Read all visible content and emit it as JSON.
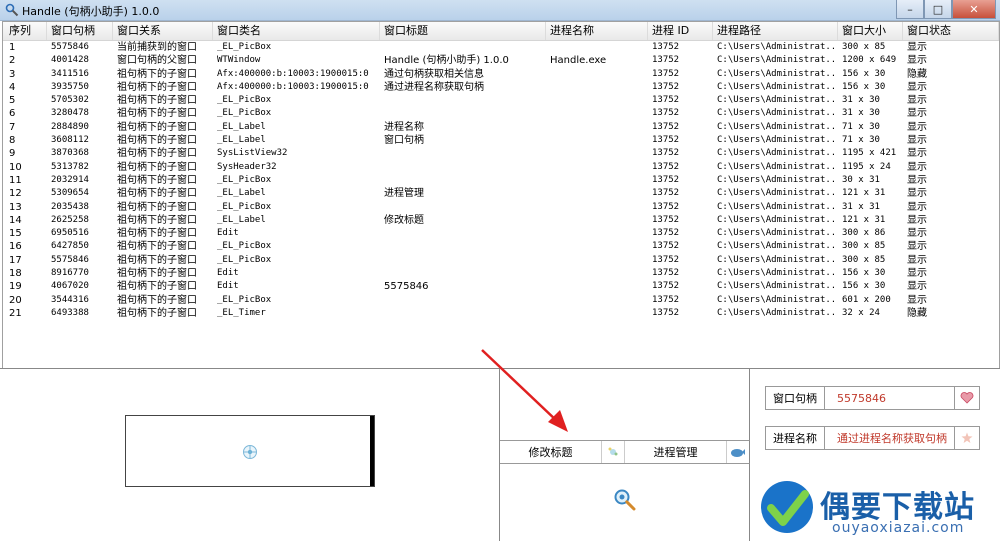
{
  "window": {
    "title": "Handle (句柄小助手) 1.0.0",
    "min": "–",
    "max": "□",
    "close": "✕"
  },
  "table": {
    "columns": [
      "序列",
      "窗口句柄",
      "窗口关系",
      "窗口类名",
      "窗口标题",
      "进程名称",
      "进程 ID",
      "进程路径",
      "窗口大小",
      "窗口状态"
    ],
    "rows": [
      [
        "1",
        "5575846",
        "当前捕获到的窗口",
        "_EL_PicBox",
        "",
        "",
        "13752",
        "C:\\Users\\Administrat...",
        "300 x 85",
        "显示"
      ],
      [
        "2",
        "4001428",
        "窗口句柄的父窗口",
        "WTWindow",
        "Handle (句柄小助手) 1.0.0",
        "Handle.exe",
        "13752",
        "C:\\Users\\Administrat...",
        "1200 x 649",
        "显示"
      ],
      [
        "3",
        "3411516",
        "祖句柄下的子窗口",
        "Afx:400000:b:10003:1900015:0",
        "通过句柄获取相关信息",
        "",
        "13752",
        "C:\\Users\\Administrat...",
        "156 x 30",
        "隐藏"
      ],
      [
        "4",
        "3935750",
        "祖句柄下的子窗口",
        "Afx:400000:b:10003:1900015:0",
        "通过进程名称获取句柄",
        "",
        "13752",
        "C:\\Users\\Administrat...",
        "156 x 30",
        "显示"
      ],
      [
        "5",
        "5705302",
        "祖句柄下的子窗口",
        "_EL_PicBox",
        "",
        "",
        "13752",
        "C:\\Users\\Administrat...",
        "31 x 30",
        "显示"
      ],
      [
        "6",
        "3280478",
        "祖句柄下的子窗口",
        "_EL_PicBox",
        "",
        "",
        "13752",
        "C:\\Users\\Administrat...",
        "31 x 30",
        "显示"
      ],
      [
        "7",
        "2884890",
        "祖句柄下的子窗口",
        "_EL_Label",
        "进程名称",
        "",
        "13752",
        "C:\\Users\\Administrat...",
        "71 x 30",
        "显示"
      ],
      [
        "8",
        "3608112",
        "祖句柄下的子窗口",
        "_EL_Label",
        "窗口句柄",
        "",
        "13752",
        "C:\\Users\\Administrat...",
        "71 x 30",
        "显示"
      ],
      [
        "9",
        "3870368",
        "祖句柄下的子窗口",
        "SysListView32",
        "",
        "",
        "13752",
        "C:\\Users\\Administrat...",
        "1195 x 421",
        "显示"
      ],
      [
        "10",
        "5313782",
        "祖句柄下的子窗口",
        "SysHeader32",
        "",
        "",
        "13752",
        "C:\\Users\\Administrat...",
        "1195 x 24",
        "显示"
      ],
      [
        "11",
        "2032914",
        "祖句柄下的子窗口",
        "_EL_PicBox",
        "",
        "",
        "13752",
        "C:\\Users\\Administrat...",
        "30 x 31",
        "显示"
      ],
      [
        "12",
        "5309654",
        "祖句柄下的子窗口",
        "_EL_Label",
        "进程管理",
        "",
        "13752",
        "C:\\Users\\Administrat...",
        "121 x 31",
        "显示"
      ],
      [
        "13",
        "2035438",
        "祖句柄下的子窗口",
        "_EL_PicBox",
        "",
        "",
        "13752",
        "C:\\Users\\Administrat...",
        "31 x 31",
        "显示"
      ],
      [
        "14",
        "2625258",
        "祖句柄下的子窗口",
        "_EL_Label",
        "修改标题",
        "",
        "13752",
        "C:\\Users\\Administrat...",
        "121 x 31",
        "显示"
      ],
      [
        "15",
        "6950516",
        "祖句柄下的子窗口",
        "Edit",
        "",
        "",
        "13752",
        "C:\\Users\\Administrat...",
        "300 x 86",
        "显示"
      ],
      [
        "16",
        "6427850",
        "祖句柄下的子窗口",
        "_EL_PicBox",
        "",
        "",
        "13752",
        "C:\\Users\\Administrat...",
        "300 x 85",
        "显示"
      ],
      [
        "17",
        "5575846",
        "祖句柄下的子窗口",
        "_EL_PicBox",
        "",
        "",
        "13752",
        "C:\\Users\\Administrat...",
        "300 x 85",
        "显示"
      ],
      [
        "18",
        "8916770",
        "祖句柄下的子窗口",
        "Edit",
        "",
        "",
        "13752",
        "C:\\Users\\Administrat...",
        "156 x 30",
        "显示"
      ],
      [
        "19",
        "4067020",
        "祖句柄下的子窗口",
        "Edit",
        "5575846",
        "",
        "13752",
        "C:\\Users\\Administrat...",
        "156 x 30",
        "显示"
      ],
      [
        "20",
        "3544316",
        "祖句柄下的子窗口",
        "_EL_PicBox",
        "",
        "",
        "13752",
        "C:\\Users\\Administrat...",
        "601 x 200",
        "显示"
      ],
      [
        "21",
        "6493388",
        "祖句柄下的子窗口",
        "_EL_Timer",
        "",
        "",
        "13752",
        "C:\\Users\\Administrat...",
        "32 x 24",
        "隐藏"
      ]
    ]
  },
  "buttons": {
    "edit_title": "修改标题",
    "process_mgmt": "进程管理"
  },
  "fields": {
    "handle_label": "窗口句柄",
    "handle_value": "5575846",
    "process_label": "进程名称",
    "process_value": "通过进程名称获取句柄"
  },
  "watermark": {
    "brand": "偶要下载站",
    "url": "ouyaoxiazai.com"
  },
  "colors": {
    "accent_red": "#c0392b",
    "brand_blue": "#1a5fa8"
  }
}
